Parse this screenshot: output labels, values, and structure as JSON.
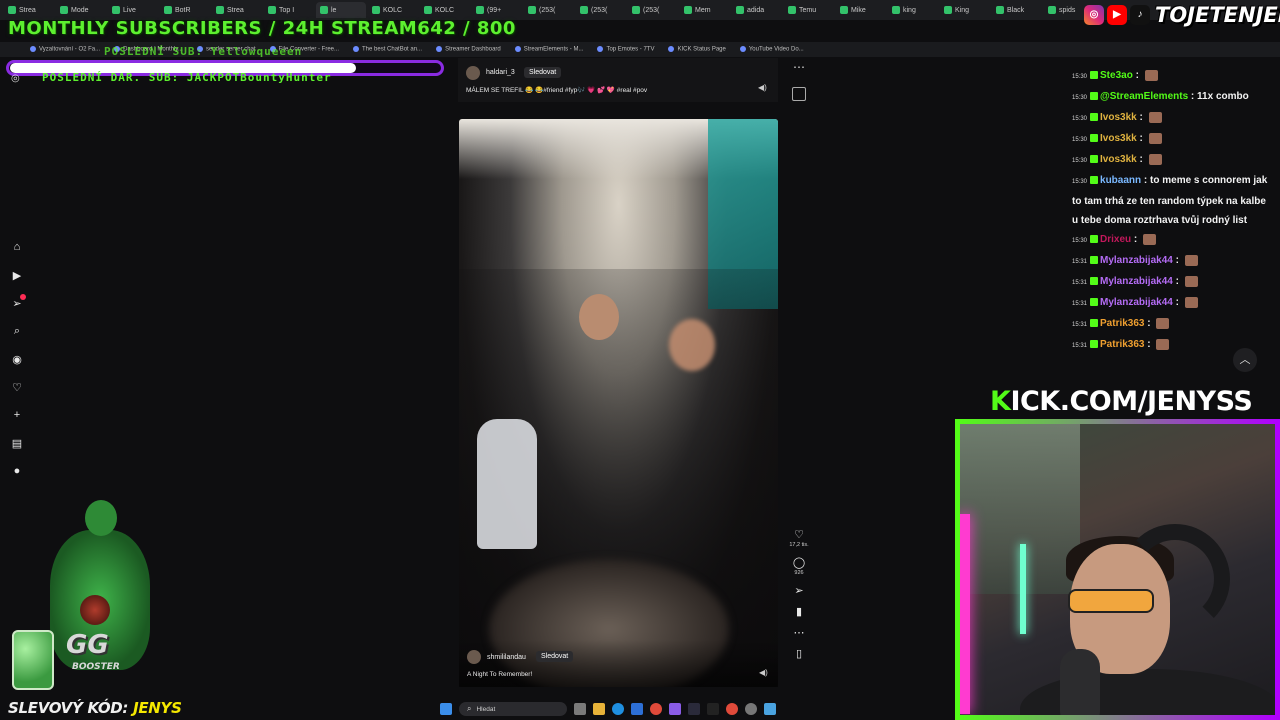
{
  "browser": {
    "tabs": [
      "Strea",
      "Mode",
      "Live",
      "BotR",
      "Strea",
      "Top I",
      "le",
      "KOLC",
      "KOLC",
      "(99+",
      "(253(",
      "(253(",
      "(253(",
      "Mem",
      "adida",
      "Temu",
      "Mike",
      "king",
      "King",
      "Black",
      "spids"
    ],
    "bookmarks": [
      "Vyzaltovnání - O2 Fa...",
      "Dashboard | Monthly...",
      "sender server chat",
      "File Converter - Free...",
      "The best ChatBot an...",
      "Streamer Dashboard",
      "StreamElements - M...",
      "Top Emotes - 7TV",
      "KICK Status Page",
      "YouTube Video Do..."
    ]
  },
  "overlay": {
    "banner": "MONTHLY SUBSCRIBERS / 24H STREAM642 / 800",
    "last_sub": "POSLEDNÍ SUB: Yellowqueeen",
    "last_donation": "POSLEDNÍ DAR. SUB: JACKPOTBountyHunter",
    "brand": "TOJETENJENYS",
    "kick_prefix": "K",
    "kick_rest": "ICK.COM/JENYSS",
    "promo_label": "SLEVOVÝ KÓD:",
    "promo_code": "JENYS",
    "booster_main": "GG",
    "booster_sub": "BOOSTER"
  },
  "rail_icons": [
    "home-icon",
    "video-icon",
    "inbox-icon",
    "search-icon",
    "explore-icon",
    "likes-icon",
    "plus-icon",
    "stats-icon",
    "profile-icon"
  ],
  "inbox_badge": "1",
  "post_top": {
    "username": "haldari_3",
    "follow_label": "Sledovat",
    "caption": "MÁLEM SE TREFIL 😂 😂#friend #fyp🎶 💗 💕 💖 #real #pov"
  },
  "post_bottom": {
    "username": "shmililandau",
    "follow_label": "Sledovat",
    "caption": "A Night To Remember!"
  },
  "actions": {
    "likes": "17,2 tis.",
    "comments": "926"
  },
  "chat": [
    {
      "ts": "15:30",
      "user": "Ste3ao",
      "color": "#53fc18",
      "text": ""
    },
    {
      "ts": "15:30",
      "user": "@StreamElements",
      "color": "#53fc18",
      "text": "11x combo"
    },
    {
      "ts": "15:30",
      "user": "Ivos3kk",
      "color": "#e0b340",
      "text": ""
    },
    {
      "ts": "15:30",
      "user": "Ivos3kk",
      "color": "#e0b340",
      "text": ""
    },
    {
      "ts": "15:30",
      "user": "Ivos3kk",
      "color": "#e0b340",
      "text": ""
    },
    {
      "ts": "15:30",
      "user": "kubaann",
      "color": "#7ab8ff",
      "text": "to meme s connorem jak to tam trhá ze ten random týpek na kalbe u tebe doma roztrhava tvůj rodný list"
    },
    {
      "ts": "15:30",
      "user": "Drixeu",
      "color": "#c2185b",
      "text": ""
    },
    {
      "ts": "15:31",
      "user": "Mylanzabijak44",
      "color": "#b46cf5",
      "text": ""
    },
    {
      "ts": "15:31",
      "user": "Mylanzabijak44",
      "color": "#b46cf5",
      "text": ""
    },
    {
      "ts": "15:31",
      "user": "Mylanzabijak44",
      "color": "#b46cf5",
      "text": ""
    },
    {
      "ts": "15:31",
      "user": "Patrik363",
      "color": "#f0a030",
      "text": ""
    },
    {
      "ts": "15:31",
      "user": "Patrik363",
      "color": "#f0a030",
      "text": ""
    }
  ],
  "taskbar": {
    "search_placeholder": "Hledat"
  }
}
